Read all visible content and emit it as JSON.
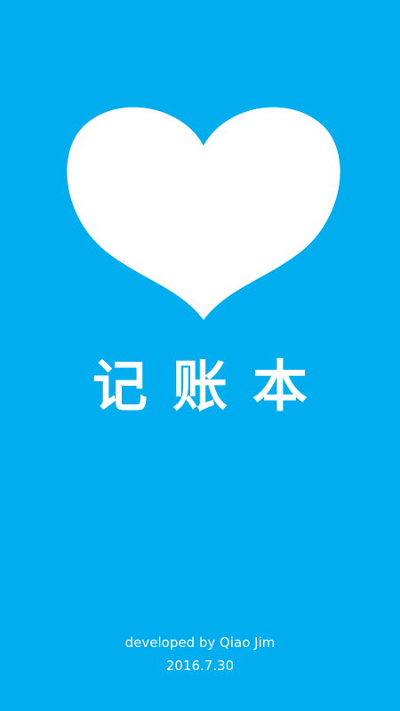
{
  "app": {
    "title": "记账本",
    "background_color": "#00adef",
    "logo_icon": "heart-icon",
    "logo_color": "#ffffff"
  },
  "footer": {
    "developer_text": "developed by Qiao Jim",
    "date": "2016.7.30"
  }
}
